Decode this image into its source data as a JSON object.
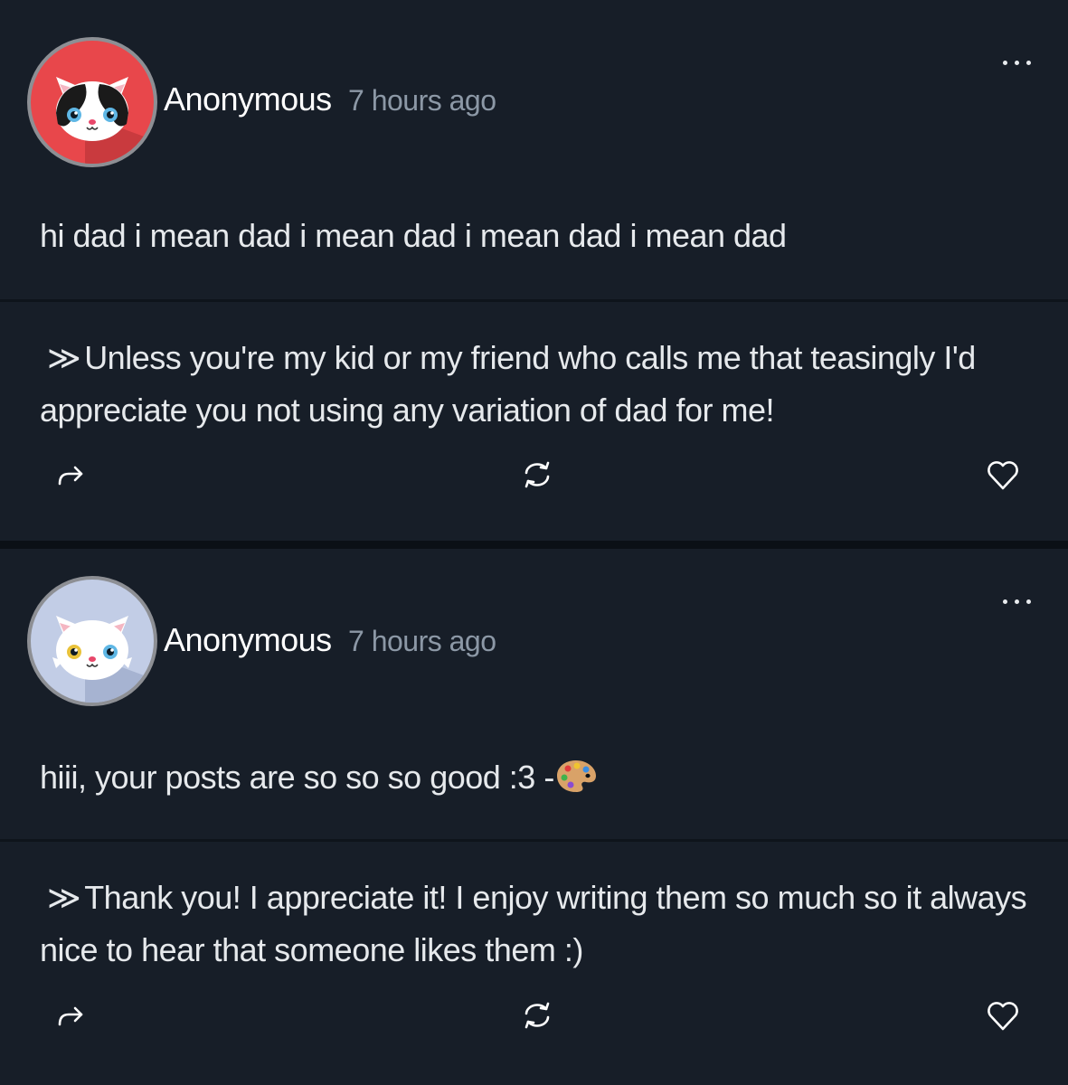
{
  "posts": [
    {
      "author": "Anonymous",
      "time": "7 hours ago",
      "avatar_icon": "cat-avatar-red",
      "question": "hi dad i mean dad i mean dad i mean dad i mean dad",
      "answer_marker": "≫",
      "answer": "Unless you're my kid or my friend who calls me that teasingly I'd appreciate you not using any variation of dad for me!",
      "actions": [
        "share-icon",
        "repost-icon",
        "heart-icon"
      ]
    },
    {
      "author": "Anonymous",
      "time": "7 hours ago",
      "avatar_icon": "cat-avatar-blue",
      "question": "hiii, your posts are so so so good :3 -",
      "question_emoji": "palette-emoji",
      "answer_marker": "≫",
      "answer": "Thank you! I appreciate it! I enjoy writing them so much so it always nice to hear that someone likes them :)",
      "actions": [
        "share-icon",
        "repost-icon",
        "heart-icon"
      ]
    }
  ],
  "colors": {
    "background": "#0b1016",
    "card": "#171e28",
    "avatar_red": "#e8474b",
    "avatar_blue": "#c2cde6",
    "timestamp": "#8c98a6"
  }
}
